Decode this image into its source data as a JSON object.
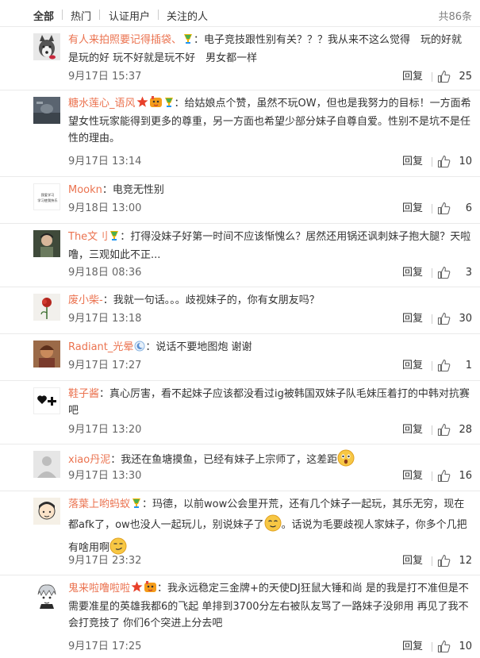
{
  "tabs": [
    "全部",
    "热门",
    "认证用户",
    "关注的人"
  ],
  "total": "共86条",
  "reply_label": "回复",
  "comments": [
    {
      "name": "有人来拍照要记得插袋、",
      "text": "：电子竞技跟性别有关？？？我从来不这么觉得　玩的好就是玩的好 玩不好就是玩不好　男女都一样",
      "time": "9月17日 15:37",
      "likes": "25"
    },
    {
      "name": "糖水莲心_语风",
      "text": "：给姑娘点个赞，虽然不玩OW，但也是我努力的目标！一方面希望女性玩家能得到更多的尊重，另一方面也希望少部分妹子自尊自爱。性别不是坑不是任性的理由。",
      "time": "9月17日 13:14",
      "likes": "10"
    },
    {
      "name": "Mookn",
      "text": "：电竞无性别",
      "time": "9月18日 13:00",
      "likes": "6",
      "avatar_text": "我爱学习 学习使我快乐"
    },
    {
      "name": "The文刂",
      "text": "：打得没妹子好第一时间不应该惭愧么？居然还用锅还讽刺妹子抱大腿？天啦噜，三观如此不正...",
      "time": "9月18日 08:36",
      "likes": "3"
    },
    {
      "name": "废小柴-",
      "text": "：我就一句话。。。歧视妹子的，你有女朋友吗？",
      "time": "9月17日 13:18",
      "likes": "30"
    },
    {
      "name": "Radiant_光晕",
      "text": "：说话不要地图炮 谢谢",
      "time": "9月17日 17:27",
      "likes": "1"
    },
    {
      "name": "鞋子酱",
      "text": "：真心厉害，看不起妹子应该都没看过ig被韩国双妹子队毛妹压着打的中韩对抗赛吧",
      "time": "9月17日 13:20",
      "likes": "28"
    },
    {
      "name": "xiao丹泥",
      "text": "：我还在鱼塘摸鱼，已经有妹子上宗师了，这差距",
      "time": "9月17日 13:30",
      "likes": "16"
    },
    {
      "name": "落葉上哟蚂蚁",
      "text": "：玛德，以前wow公会里开荒，还有几个妹子一起玩，其乐无穷，现在都afk了，ow也没人一起玩儿，别说妹子了",
      "text2": "。话说为毛要歧视人家妹子，你多个几把有啥用啊",
      "time": "9月17日 23:32",
      "likes": "12"
    },
    {
      "name": "鬼来啦噜啦啦",
      "text": "：我永远稳定三金牌+的天使DJ狂鼠大锤和尚 是的我是打不准但是不需要准星的英雄我都6的飞起 单排到3700分左右被队友骂了一路妹子没卵用 再见了我不会打竞技了 你们6个突进上分去吧",
      "time": "9月17日 17:25",
      "likes": "10"
    }
  ],
  "colors": {
    "name": "#eb7350",
    "time": "#666666",
    "text": "#333333",
    "divider": "#eaeaea"
  }
}
